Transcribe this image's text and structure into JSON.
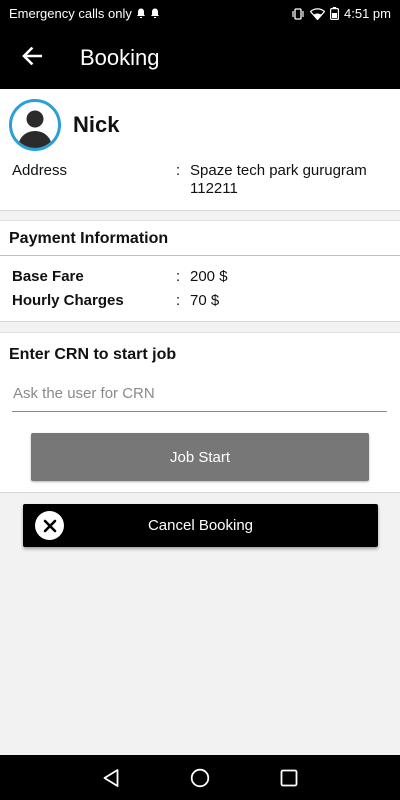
{
  "status_bar": {
    "carrier_text": "Emergency calls only",
    "time": "4:51 pm"
  },
  "app_bar": {
    "title": "Booking"
  },
  "profile": {
    "name": "Nick",
    "address_label": "Address",
    "separator": ":",
    "address_value": "Spaze tech park gurugram 112211"
  },
  "payment": {
    "section_title": "Payment Information",
    "rows": [
      {
        "label": "Base Fare",
        "separator": ":",
        "value": "200 $"
      },
      {
        "label": "Hourly Charges",
        "separator": ":",
        "value": "70 $"
      }
    ]
  },
  "crn": {
    "section_title": "Enter CRN to start job",
    "input_value": "",
    "input_placeholder": "Ask the user for CRN",
    "start_label": "Job Start"
  },
  "cancel": {
    "label": "Cancel Booking"
  },
  "colors": {
    "app_bar": "#000000",
    "avatar_ring": "#2a9fd8",
    "job_start_button": "#777777",
    "cancel_button": "#000000"
  },
  "icons": {
    "back": "arrow-left-icon",
    "avatar": "person-silhouette-icon",
    "cancel": "close-circle-icon",
    "nav_back": "triangle-back-icon",
    "nav_home": "circle-home-icon",
    "nav_recents": "square-recents-icon"
  }
}
